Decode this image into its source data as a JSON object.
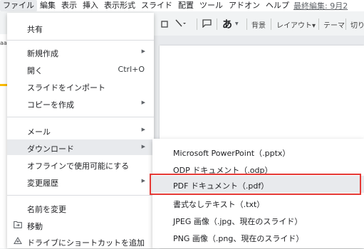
{
  "menubar": {
    "items": [
      "ファイル",
      "編集",
      "表示",
      "挿入",
      "表示形式",
      "スライド",
      "配置",
      "ツール",
      "アドオン",
      "ヘルプ"
    ],
    "last_edit": "最終編集: 9月2"
  },
  "toolbar": {
    "bold_a": "あ",
    "bg": "背景",
    "layout": "レイアウト▾",
    "theme": "テーマ",
    "transition": "切り"
  },
  "left_strip": {
    "fragment": "aa"
  },
  "file_menu": {
    "share": "共有",
    "new": "新規作成",
    "open": "開く",
    "open_shortcut": "Ctrl+O",
    "import": "スライドをインポート",
    "copy": "コピーを作成",
    "email": "メール",
    "download": "ダウンロード",
    "offline": "オフラインで使用可能にする",
    "history": "変更履歴",
    "rename": "名前を変更",
    "move": "移動",
    "shortcut": "ドライブにショートカットを追加"
  },
  "submenu": {
    "items": [
      "Microsoft PowerPoint（.pptx）",
      "ODP ドキュメント（.odp）",
      "PDF ドキュメント（.pdf）",
      "書式なしテキスト（.txt）",
      "JPEG 画像（.jpg、現在のスライド）",
      "PNG 画像（.png、現在のスライド）"
    ]
  },
  "slide": {
    "text": "aaa"
  },
  "colors": {
    "highlight": "#e53935",
    "accent": "#fbbc04"
  }
}
